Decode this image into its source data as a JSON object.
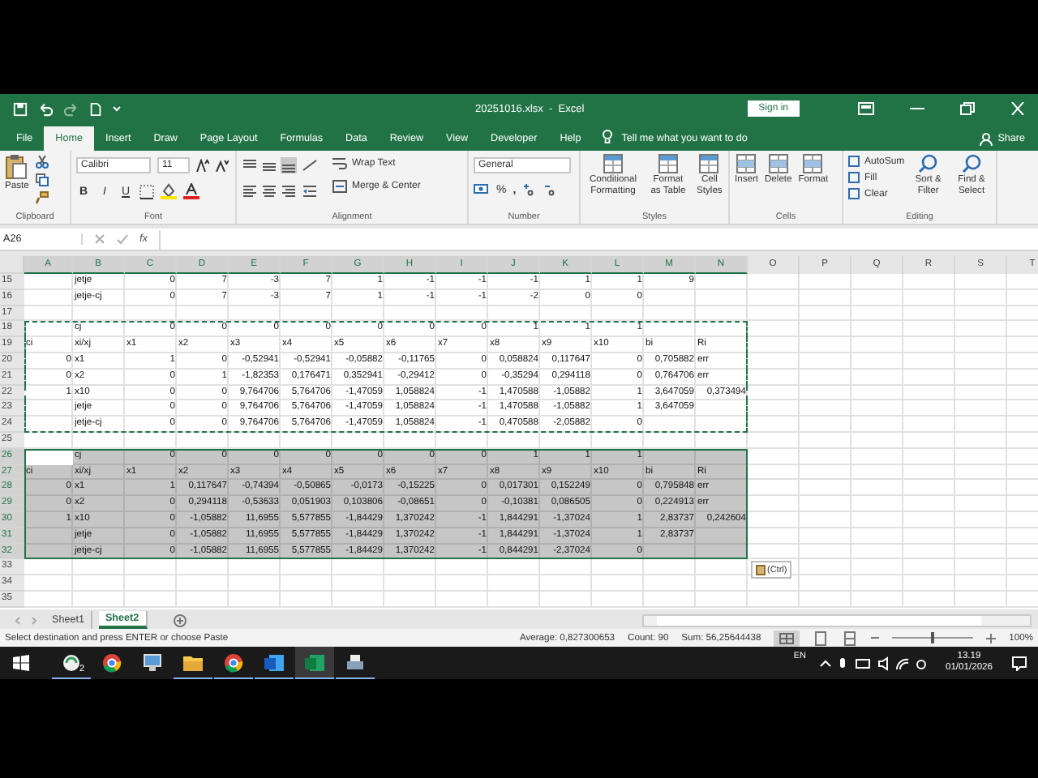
{
  "title_bar": {
    "title": "20251016.xlsx  -  Excel",
    "sign_in": "Sign in"
  },
  "tabs": [
    {
      "label": "File",
      "selected": false
    },
    {
      "label": "Home",
      "selected": true
    },
    {
      "label": "Insert",
      "selected": false
    },
    {
      "label": "Draw",
      "selected": false
    },
    {
      "label": "Page Layout",
      "selected": false
    },
    {
      "label": "Formulas",
      "selected": false
    },
    {
      "label": "Data",
      "selected": false
    },
    {
      "label": "Review",
      "selected": false
    },
    {
      "label": "View",
      "selected": false
    },
    {
      "label": "Developer",
      "selected": false
    },
    {
      "label": "Help",
      "selected": false
    }
  ],
  "tell_me": "Tell me what you want to do",
  "share": "Share",
  "ribbon": {
    "clipboard": {
      "paste": "Paste",
      "label": "Clipboard"
    },
    "font": {
      "name": "Calibri",
      "size": "11",
      "bold": "B",
      "italic": "I",
      "underline": "U",
      "label": "Font"
    },
    "alignment": {
      "wrap": "Wrap Text",
      "merge": "Merge & Center",
      "label": "Alignment"
    },
    "number": {
      "format": "General",
      "percent": "%",
      "comma": ",",
      "label": "Number"
    },
    "styles": {
      "buttons": [
        "Conditional Formatting",
        "Format as Table",
        "Cell Styles"
      ],
      "label": "Styles"
    },
    "cells": {
      "buttons": [
        "Insert",
        "Delete",
        "Format"
      ],
      "label": "Cells"
    },
    "editing": {
      "small": [
        "AutoSum",
        "Fill",
        "Clear"
      ],
      "large": [
        "Sort & Filter",
        "Find & Select"
      ],
      "label": "Editing"
    }
  },
  "formula_bar": {
    "name_box": "A26",
    "fx": "fx"
  },
  "grid": {
    "columns": [
      {
        "label": "A",
        "selected": true
      },
      {
        "label": "B",
        "selected": true
      },
      {
        "label": "C",
        "selected": true
      },
      {
        "label": "D",
        "selected": true
      },
      {
        "label": "E",
        "selected": true
      },
      {
        "label": "F",
        "selected": true
      },
      {
        "label": "G",
        "selected": true
      },
      {
        "label": "H",
        "selected": true
      },
      {
        "label": "I",
        "selected": true
      },
      {
        "label": "J",
        "selected": true
      },
      {
        "label": "K",
        "selected": true
      },
      {
        "label": "L",
        "selected": true
      },
      {
        "label": "M",
        "selected": true
      },
      {
        "label": "N",
        "selected": true
      },
      {
        "label": "O",
        "selected": false
      },
      {
        "label": "P",
        "selected": false
      },
      {
        "label": "Q",
        "selected": false
      },
      {
        "label": "R",
        "selected": false
      },
      {
        "label": "S",
        "selected": false
      },
      {
        "label": "T",
        "selected": false
      }
    ],
    "rows": [
      {
        "number": "15",
        "copied": false,
        "selected": false,
        "cells": [
          null,
          "jetje",
          "0",
          "7",
          "-3",
          "7",
          "1",
          "-1",
          "-1",
          "-1",
          "1",
          "1",
          "9",
          null
        ]
      },
      {
        "number": "16",
        "copied": false,
        "selected": false,
        "cells": [
          null,
          "jetje-cj",
          "0",
          "7",
          "-3",
          "7",
          "1",
          "-1",
          "-1",
          "-2",
          "0",
          "0",
          null,
          null
        ]
      },
      {
        "number": "17",
        "copied": false,
        "selected": false
      },
      {
        "number": "18",
        "copied": true,
        "selected": false,
        "cells": [
          null,
          "cj",
          "0",
          "0",
          "0",
          "0",
          "0",
          "0",
          "0",
          "1",
          "1",
          "1",
          null,
          null
        ]
      },
      {
        "number": "19",
        "copied": true,
        "selected": false,
        "cells": [
          "ci",
          "xi/xj",
          "x1",
          "x2",
          "x3",
          "x4",
          "x5",
          "x6",
          "x7",
          "x8",
          "x9",
          "x10",
          "bi",
          "Ri"
        ]
      },
      {
        "number": "20",
        "copied": true,
        "selected": false,
        "cells": [
          "0",
          "x1",
          "1",
          "0",
          "-0,52941",
          "-0,52941",
          "-0,05882",
          "-0,11765",
          "0",
          "0,058824",
          "0,117647",
          "0",
          "0,705882",
          "err"
        ]
      },
      {
        "number": "21",
        "copied": true,
        "selected": false,
        "cells": [
          "0",
          "x2",
          "0",
          "1",
          "-1,82353",
          "0,176471",
          "0,352941",
          "-0,29412",
          "0",
          "-0,35294",
          "0,294118",
          "0",
          "0,764706",
          "err"
        ]
      },
      {
        "number": "22",
        "copied": true,
        "selected": false,
        "cells": [
          "1",
          "x10",
          "0",
          "0",
          "9,764706",
          "5,764706",
          "-1,47059",
          "1,058824",
          "-1",
          "1,470588",
          "-1,05882",
          "1",
          "3,647059",
          "0,373494"
        ]
      },
      {
        "number": "23",
        "copied": true,
        "selected": false,
        "cells": [
          null,
          "jetje",
          "0",
          "0",
          "9,764706",
          "5,764706",
          "-1,47059",
          "1,058824",
          "-1",
          "1,470588",
          "-1,05882",
          "1",
          "3,647059",
          null
        ]
      },
      {
        "number": "24",
        "copied": true,
        "selected": false,
        "cells": [
          null,
          "jetje-cj",
          "0",
          "0",
          "9,764706",
          "5,764706",
          "-1,47059",
          "1,058824",
          "-1",
          "0,470588",
          "-2,05882",
          "0",
          null,
          null
        ]
      },
      {
        "number": "25",
        "copied": false,
        "selected": false
      },
      {
        "number": "26",
        "copied": false,
        "selected": true,
        "active_cell": true,
        "cells": [
          null,
          "cj",
          "0",
          "0",
          "0",
          "0",
          "0",
          "0",
          "0",
          "1",
          "1",
          "1",
          null,
          null
        ]
      },
      {
        "number": "27",
        "copied": false,
        "selected": true,
        "cells": [
          "ci",
          "xi/xj",
          "x1",
          "x2",
          "x3",
          "x4",
          "x5",
          "x6",
          "x7",
          "x8",
          "x9",
          "x10",
          "bi",
          "Ri"
        ]
      },
      {
        "number": "28",
        "copied": false,
        "selected": true,
        "cells": [
          "0",
          "x1",
          "1",
          "0,117647",
          "-0,74394",
          "-0,50865",
          "-0,0173",
          "-0,15225",
          "0",
          "0,017301",
          "0,152249",
          "0",
          "0,795848",
          "err"
        ]
      },
      {
        "number": "29",
        "copied": false,
        "selected": true,
        "cells": [
          "0",
          "x2",
          "0",
          "0,294118",
          "-0,53633",
          "0,051903",
          "0,103806",
          "-0,08651",
          "0",
          "-0,10381",
          "0,086505",
          "0",
          "0,224913",
          "err"
        ]
      },
      {
        "number": "30",
        "copied": false,
        "selected": true,
        "cells": [
          "1",
          "x10",
          "0",
          "-1,05882",
          "11,6955",
          "5,577855",
          "-1,84429",
          "1,370242",
          "-1",
          "1,844291",
          "-1,37024",
          "1",
          "2,83737",
          "0,242604"
        ]
      },
      {
        "number": "31",
        "copied": false,
        "selected": true,
        "cells": [
          null,
          "jetje",
          "0",
          "-1,05882",
          "11,6955",
          "5,577855",
          "-1,84429",
          "1,370242",
          "-1",
          "1,844291",
          "-1,37024",
          "1",
          "2,83737",
          null
        ]
      },
      {
        "number": "32",
        "copied": false,
        "selected": true,
        "cells": [
          null,
          "jetje-cj",
          "0",
          "-1,05882",
          "11,6955",
          "5,577855",
          "-1,84429",
          "1,370242",
          "-1",
          "0,844291",
          "-2,37024",
          "0",
          null,
          null
        ]
      },
      {
        "number": "33",
        "copied": false,
        "selected": false
      },
      {
        "number": "34",
        "copied": false,
        "selected": false
      },
      {
        "number": "35",
        "copied": false,
        "selected": false
      }
    ]
  },
  "paste_options": "(Ctrl)",
  "sheets": [
    {
      "label": "Sheet1",
      "selected": false
    },
    {
      "label": "Sheet2",
      "selected": true
    }
  ],
  "status_bar": {
    "message": "Select destination and press ENTER or choose Paste",
    "average": "Average: 0,827300653",
    "count": "Count: 90",
    "sum": "Sum: 56,25644438",
    "zoom": {
      "level": 0.5
    },
    "zoom_label": "100%"
  },
  "taskbar": {
    "apps": [
      {
        "kind": "sync",
        "badge": "2",
        "running": true,
        "active": false
      },
      {
        "kind": "browser",
        "running": false,
        "active": false
      },
      {
        "kind": "network",
        "running": false,
        "active": false
      },
      {
        "kind": "folder",
        "running": true,
        "active": false
      },
      {
        "kind": "browser-user",
        "running": true,
        "active": false
      },
      {
        "kind": "word",
        "running": true,
        "active": false
      },
      {
        "kind": "excel",
        "running": true,
        "active": true
      },
      {
        "kind": "printer",
        "running": true,
        "active": false
      }
    ],
    "language": "EN",
    "time": "13.19",
    "date": "01/01/2026"
  }
}
